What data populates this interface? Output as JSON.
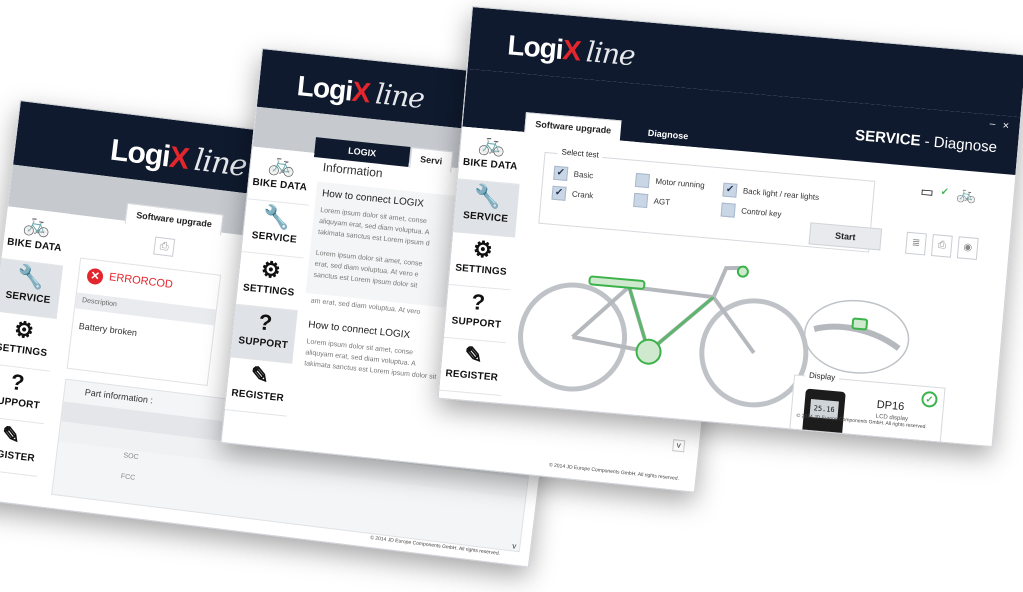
{
  "colors": {
    "header": "#0f1a2e",
    "accent_red": "#e3262d",
    "green": "#3bb34a",
    "band": "#c6cacf"
  },
  "logo": {
    "logi": "Logi",
    "x": "X",
    "line": "line"
  },
  "sidebar": {
    "bike_data": "BIKE DATA",
    "service": "SERVICE",
    "settings": "SETTINGS",
    "support": "SUPPORT",
    "register": "REGISTER"
  },
  "window1": {
    "tab_software": "Software upgrade",
    "error_title": "ERRORCOD",
    "description_header": "Description",
    "error_description": "Battery broken",
    "part_info_header": "Part information :",
    "soc_label": "SOC",
    "fcc_label": "FCC",
    "footer": "© 2014 JD Europe Components GmbH. All rights reserved."
  },
  "window2": {
    "tab_logix": "LOGIX",
    "tab_service": "Servi",
    "info_title": "Information",
    "connect_title_1": "How to connect LOGIX",
    "connect_title_2": "How to connect LOGIX",
    "lorem_1": "Lorem ipsum dolor sit amet, conse",
    "lorem_2": "aliquyam erat, sed diam voluptua. A",
    "lorem_3": "takimata sanctus est Lorem ipsum d",
    "lorem_4": "Lorem ipsum dolor sit amet, conse",
    "lorem_5": "erat, sed diam voluptua. At vero e",
    "lorem_6": "sanctus est Lorem ipsum dolor sit",
    "lorem_7": "am erat, sed diam voluptua. At vero",
    "lorem_8": "Lorem ipsum dolor sit amet, conse",
    "lorem_9": "aliquyam erat, sed diam voluptua. A",
    "lorem_10": "takimata sanctus est Lorem ipsum dolor sit",
    "footer": "© 2014 JD Europe Components GmbH. All rights reserved."
  },
  "window3": {
    "title_bold": "SERVICE",
    "title_rest": " - Diagnose",
    "minimize": "–",
    "close": "×",
    "tab_software": "Software upgrade",
    "tab_diagnose": "Diagnose",
    "select_test": "Select test",
    "tests": {
      "basic": "Basic",
      "crank": "Crank",
      "motor_running": "Motor running",
      "agt": "AGT",
      "back_light": "Back light / rear lights",
      "control_key": "Control key"
    },
    "start_button": "Start",
    "display_label": "Display",
    "display_model": "DP16",
    "display_type": "LCD display",
    "info_button": "Info",
    "lcd_value": "25.16",
    "footer": "© 2014 JD Europe Components GmbH. All rights reserved."
  }
}
